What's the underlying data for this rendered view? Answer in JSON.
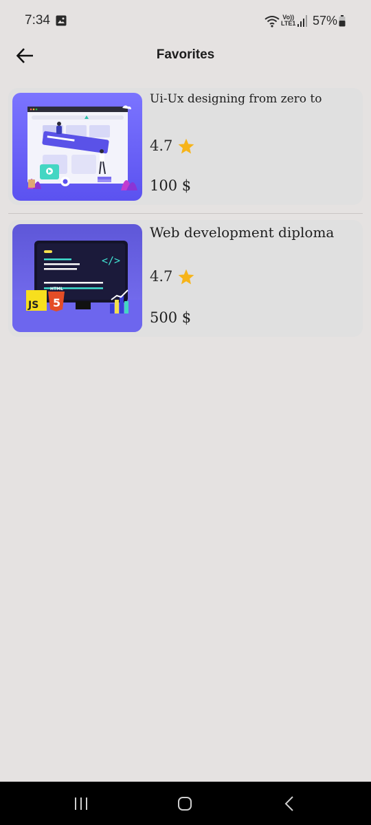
{
  "status_bar": {
    "time": "7:34",
    "volte_line1": "Vo))",
    "volte_line2": "LTE1",
    "battery": "57%"
  },
  "app_bar": {
    "title": "Favorites",
    "back_icon": "arrow-left-icon"
  },
  "favorites": [
    {
      "title": "Ui-Ux designing from zero to",
      "rating": "4.7",
      "price": "100 $",
      "thumbnail": "ui-ux-illustration"
    },
    {
      "title": "Web development diploma",
      "rating": "4.7",
      "price": "500 $",
      "thumbnail": "web-dev-illustration",
      "thumb_labels": {
        "js": "JS",
        "html": "HTML",
        "html_num": "5",
        "code": "</>"
      }
    }
  ],
  "colors": {
    "background": "#e5e2e1",
    "card": "#e0e0e0",
    "star": "#f6b41a",
    "nav_bar": "#000000",
    "thumb_purple": "#6c63ff"
  },
  "nav_bar": {
    "recent_icon": "recent-apps-icon",
    "home_icon": "home-icon",
    "back_icon": "back-icon"
  }
}
